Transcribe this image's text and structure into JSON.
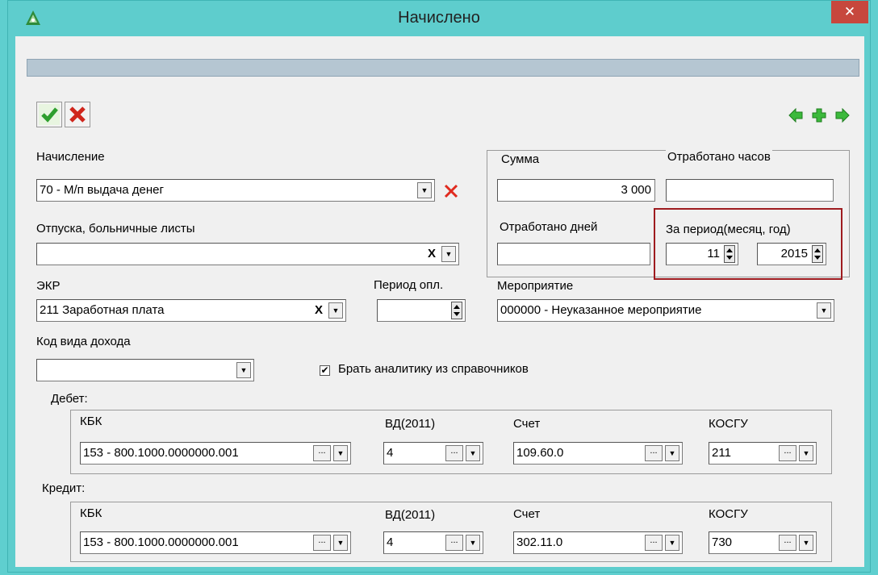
{
  "window": {
    "title": "Начислено",
    "close_glyph": "✕"
  },
  "toolbar": {
    "ok_icon": "check-icon",
    "cancel_icon": "cross-icon",
    "prev_icon": "arrow-left-icon",
    "add_icon": "plus-icon",
    "next_icon": "arrow-right-icon",
    "accent": "#2e9f2e",
    "cancel_color": "#d0261c"
  },
  "form": {
    "nachislenie": {
      "label": "Начисление",
      "value": "70 - М/п выдача денег"
    },
    "otpuska": {
      "label": "Отпуска, больничные листы",
      "value": ""
    },
    "ekr": {
      "label": "ЭКР",
      "value": "211 Заработная плата"
    },
    "period_opl": {
      "label": "Период опл.",
      "value": ""
    },
    "kod_vida": {
      "label": "Код вида дохода",
      "value": ""
    },
    "summa": {
      "label": "Сумма",
      "value": "3 000"
    },
    "hours": {
      "label": "Отработано часов",
      "value": ""
    },
    "days": {
      "label": "Отработано дней",
      "value": ""
    },
    "za_period": {
      "label": "За период(месяц, год)",
      "month": "11",
      "year": "2015"
    },
    "meropriyatie": {
      "label": "Мероприятие",
      "value": "000000 - Неуказанное мероприятие"
    },
    "brat": {
      "label": "Брать аналитику из справочников",
      "checked": true
    }
  },
  "debet": {
    "label": "Дебет:",
    "kbk_label": "КБК",
    "kbk": "153 - 800.1000.0000000.001",
    "vd_label": "ВД(2011)",
    "vd": "4",
    "schet_label": "Счет",
    "schet": "109.60.0",
    "kosgu_label": "КОСГУ",
    "kosgu": "211"
  },
  "kredit": {
    "label": "Кредит:",
    "kbk_label": "КБК",
    "kbk": "153 - 800.1000.0000000.001",
    "vd_label": "ВД(2011)",
    "vd": "4",
    "schet_label": "Счет",
    "schet": "302.11.0",
    "kosgu_label": "КОСГУ",
    "kosgu": "730"
  },
  "glyphs": {
    "dd": "▼",
    "x": "X",
    "dots": "...",
    "check": "✔"
  }
}
